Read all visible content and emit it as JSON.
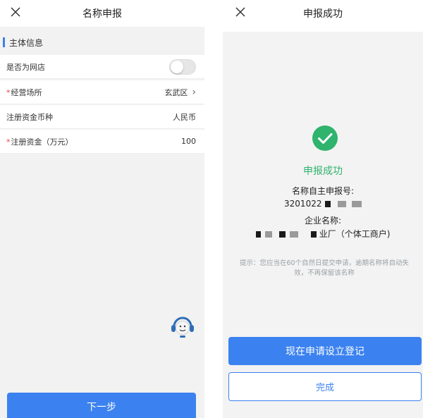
{
  "left": {
    "title": "名称申报",
    "section_title": "主体信息",
    "rows": [
      {
        "label": "是否为网店",
        "type": "toggle",
        "toggle_on": false
      },
      {
        "label": "经营场所",
        "required": "*",
        "value": "玄武区",
        "chevron": "›"
      },
      {
        "label": "注册资金币种",
        "value": "人民币"
      },
      {
        "label": "注册资金（万元）",
        "required": "*",
        "value": "100"
      }
    ],
    "next_button": "下一步",
    "icons": {
      "close": "close-icon",
      "service": "customer-service-icon"
    }
  },
  "right": {
    "title": "申报成功",
    "status_text": "申报成功",
    "number_label": "名称自主申报号:",
    "number_value": "3201022",
    "company_label": "企业名称:",
    "company_suffix": "业厂（个体工商户)",
    "hint": "提示：您应当在60个自然日提交申请，逾期名称将自动失效，不再保留该名称",
    "primary_button": "现在申请设立登记",
    "secondary_button": "完成"
  },
  "colors": {
    "accent": "#3b82f0",
    "success": "#2fb36d",
    "required": "#e64340",
    "hint": "#9aa0a6"
  }
}
